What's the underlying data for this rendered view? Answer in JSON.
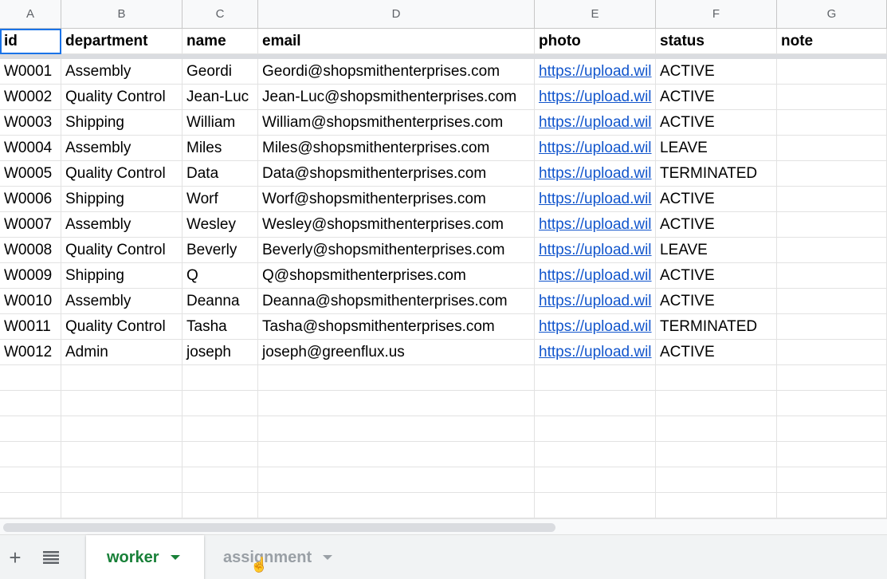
{
  "columns": [
    "A",
    "B",
    "C",
    "D",
    "E",
    "F",
    "G"
  ],
  "header_row": [
    "id",
    "department",
    "name",
    "email",
    "photo",
    "status",
    "note"
  ],
  "rows": [
    [
      "W0001",
      "Assembly",
      "Geordi",
      "Geordi@shopsmithenterprises.com",
      "https://upload.wil",
      "ACTIVE",
      ""
    ],
    [
      "W0002",
      "Quality Control",
      "Jean-Luc",
      "Jean-Luc@shopsmithenterprises.com",
      "https://upload.wil",
      "ACTIVE",
      ""
    ],
    [
      "W0003",
      "Shipping",
      "William",
      "William@shopsmithenterprises.com",
      "https://upload.wil",
      "ACTIVE",
      ""
    ],
    [
      "W0004",
      "Assembly",
      "Miles",
      "Miles@shopsmithenterprises.com",
      "https://upload.wil",
      "LEAVE",
      ""
    ],
    [
      "W0005",
      "Quality Control",
      "Data",
      "Data@shopsmithenterprises.com",
      "https://upload.wil",
      "TERMINATED",
      ""
    ],
    [
      "W0006",
      "Shipping",
      "Worf",
      "Worf@shopsmithenterprises.com",
      "https://upload.wil",
      "ACTIVE",
      ""
    ],
    [
      "W0007",
      "Assembly",
      "Wesley",
      "Wesley@shopsmithenterprises.com",
      "https://upload.wil",
      "ACTIVE",
      ""
    ],
    [
      "W0008",
      "Quality Control",
      "Beverly",
      "Beverly@shopsmithenterprises.com",
      "https://upload.wil",
      "LEAVE",
      ""
    ],
    [
      "W0009",
      "Shipping",
      "Q",
      "Q@shopsmithenterprises.com",
      "https://upload.wil",
      "ACTIVE",
      ""
    ],
    [
      "W0010",
      "Assembly",
      "Deanna",
      "Deanna@shopsmithenterprises.com",
      "https://upload.wil",
      "ACTIVE",
      ""
    ],
    [
      "W0011",
      "Quality Control",
      "Tasha",
      "Tasha@shopsmithenterprises.com",
      "https://upload.wil",
      "TERMINATED",
      ""
    ],
    [
      "W0012",
      "Admin",
      "joseph",
      "joseph@greenflux.us",
      "https://upload.wil",
      "ACTIVE",
      ""
    ]
  ],
  "empty_rows": 6,
  "tabs": [
    {
      "label": "worker",
      "active": true
    },
    {
      "label": "assignment",
      "active": false
    }
  ],
  "toolbar_icons": [
    "add-sheet-icon",
    "all-sheets-icon"
  ],
  "colors": {
    "active_tab": "#188038",
    "link": "#1155cc",
    "selection": "#1a73e8"
  }
}
